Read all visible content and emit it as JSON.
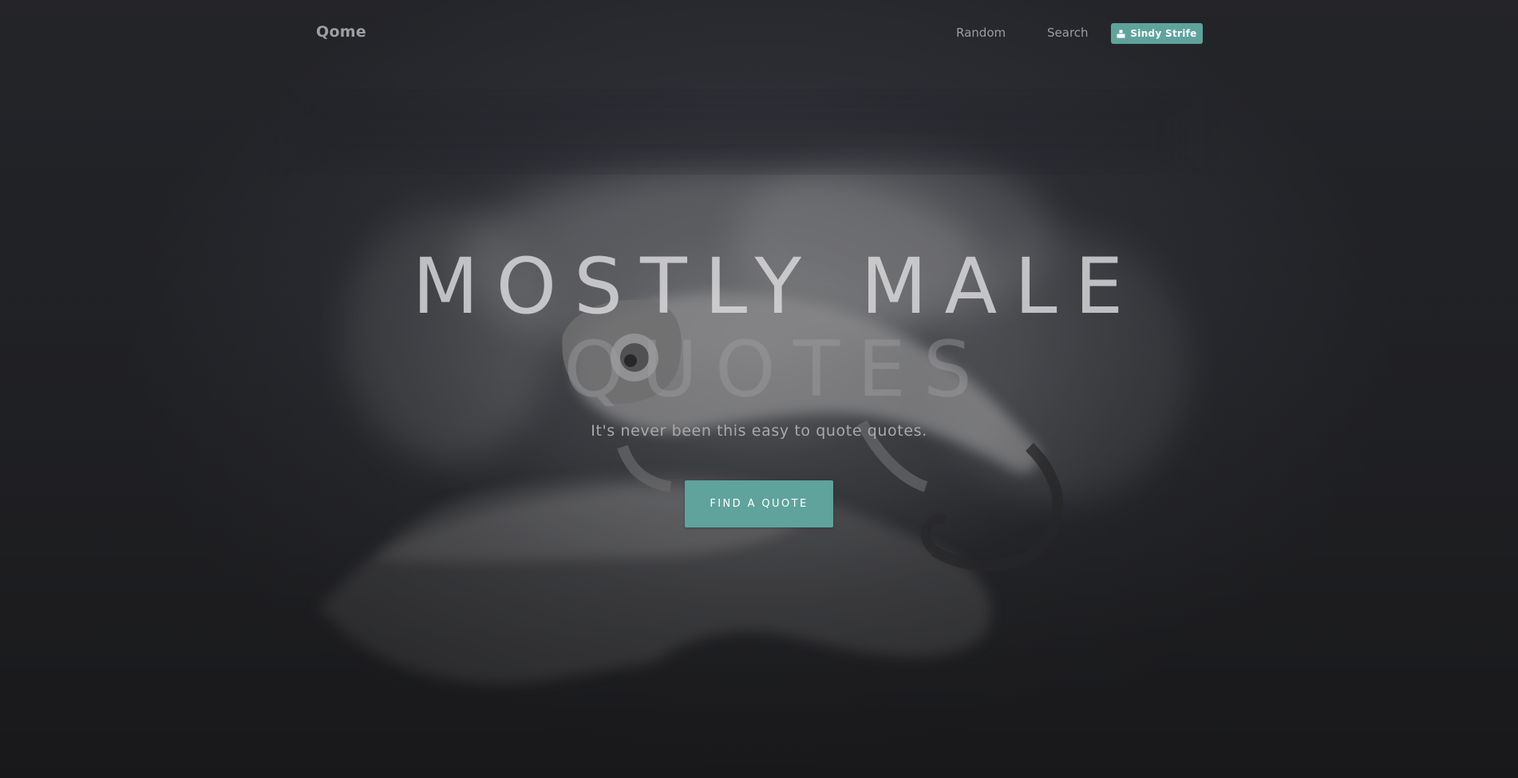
{
  "navbar": {
    "brand": "Qome",
    "links": [
      "Random",
      "Search"
    ],
    "user": {
      "name": "Sindy Strife",
      "icon": "user-icon"
    }
  },
  "hero": {
    "headline_line1": "MOSTLY MALE",
    "headline_line2": "QUOTES",
    "tagline": "It's never been this easy to quote quotes.",
    "cta_label": "FIND A QUOTE",
    "background": "grayscale photo of a chameleon on a hand"
  },
  "colors": {
    "accent": "#5fa39c",
    "background_top": "#34363d",
    "background_bottom": "#1b1b1d",
    "text_muted": "#9c9da1"
  }
}
